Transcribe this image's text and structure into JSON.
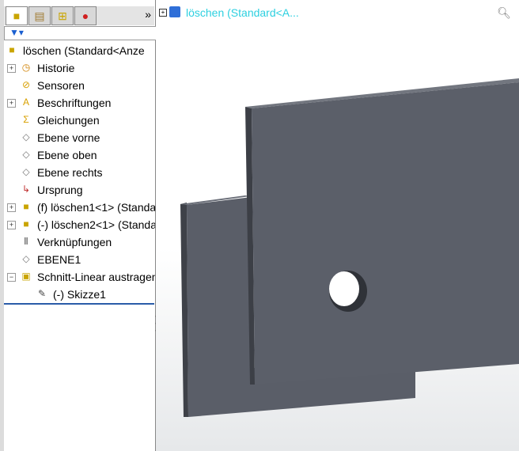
{
  "tabs": [
    {
      "icon": "feature-manager-icon"
    },
    {
      "icon": "property-manager-icon"
    },
    {
      "icon": "configuration-manager-icon"
    },
    {
      "icon": "appearance-icon"
    }
  ],
  "more_label": "»",
  "filter_icon": "filter-icon",
  "tree": [
    {
      "label": "löschen  (Standard<Anze",
      "icon": "part-icon",
      "expander": ""
    },
    {
      "label": "Historie",
      "icon": "history-icon",
      "expander": "+"
    },
    {
      "label": "Sensoren",
      "icon": "sensor-icon",
      "expander": ""
    },
    {
      "label": "Beschriftungen",
      "icon": "annotations-icon",
      "expander": "+"
    },
    {
      "label": "Gleichungen",
      "icon": "equations-icon",
      "expander": ""
    },
    {
      "label": "Ebene vorne",
      "icon": "plane-icon",
      "expander": ""
    },
    {
      "label": "Ebene oben",
      "icon": "plane-icon",
      "expander": ""
    },
    {
      "label": "Ebene rechts",
      "icon": "plane-icon",
      "expander": ""
    },
    {
      "label": "Ursprung",
      "icon": "origin-icon",
      "expander": ""
    },
    {
      "label": "(f) löschen1<1> (Standa",
      "icon": "component-icon",
      "expander": "+"
    },
    {
      "label": "(-) löschen2<1> (Standa",
      "icon": "component-icon",
      "expander": "+"
    },
    {
      "label": "Verknüpfungen",
      "icon": "mates-icon",
      "expander": ""
    },
    {
      "label": "EBENE1",
      "icon": "plane-icon",
      "expander": ""
    },
    {
      "label": "Schnitt-Linear austragen",
      "icon": "cut-extrude-icon",
      "expander": "−"
    },
    {
      "label": "(-) Skizze1",
      "icon": "sketch-icon",
      "expander": ""
    }
  ],
  "viewport": {
    "title": "löschen  (Standard<A...",
    "expander": "+"
  }
}
